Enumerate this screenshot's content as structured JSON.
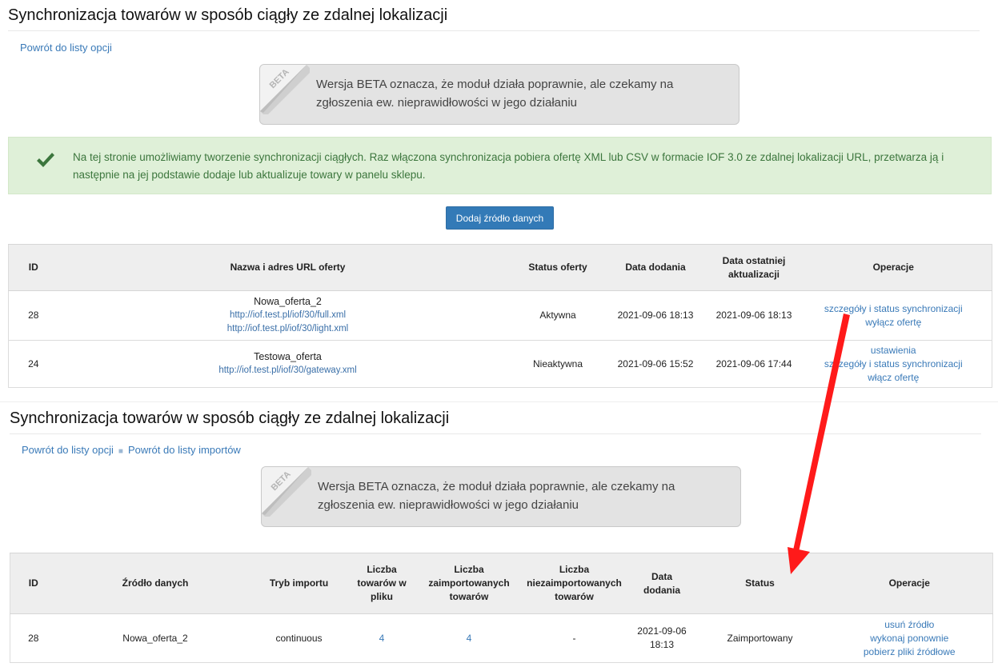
{
  "panel1": {
    "title": "Synchronizacja towarów w sposób ciągły ze zdalnej lokalizacji",
    "back_link": "Powrót do listy opcji",
    "beta_label": "BETA",
    "beta_text": "Wersja BETA oznacza, że moduł działa poprawnie, ale czekamy na zgłoszenia ew. nieprawidłowości w jego działaniu",
    "info_text": "Na tej stronie umożliwiamy tworzenie synchronizacji ciągłych. Raz włączona synchronizacja pobiera ofertę XML lub CSV w formacie IOF 3.0 ze zdalnej lokalizacji URL, przetwarza ją i następnie na jej podstawie dodaje lub aktualizuje towary w panelu sklepu.",
    "add_button": "Dodaj źródło danych",
    "table": {
      "headers": {
        "id": "ID",
        "name": "Nazwa i adres URL oferty",
        "status": "Status oferty",
        "added": "Data dodania",
        "updated": "Data ostatniej aktualizacji",
        "ops": "Operacje"
      },
      "rows": [
        {
          "id": "28",
          "name": "Nowa_oferta_2",
          "url1": "http://iof.test.pl/iof/30/full.xml",
          "url2": "http://iof.test.pl/iof/30/light.xml",
          "status": "Aktywna",
          "added": "2021-09-06 18:13",
          "updated": "2021-09-06 18:13",
          "op1": "szczegóły i status synchronizacji",
          "op2": "wyłącz ofertę"
        },
        {
          "id": "24",
          "name": "Testowa_oferta",
          "url1": "http://iof.test.pl/iof/30/gateway.xml",
          "status": "Nieaktywna",
          "added": "2021-09-06 15:52",
          "updated": "2021-09-06 17:44",
          "op1": "ustawienia",
          "op2": "szczegóły i status synchronizacji",
          "op3": "włącz ofertę"
        }
      ]
    }
  },
  "panel2": {
    "title": "Synchronizacja towarów w sposób ciągły ze zdalnej lokalizacji",
    "back_link": "Powrót do listy opcji",
    "back_link2": "Powrót do listy importów",
    "beta_label": "BETA",
    "beta_text": "Wersja BETA oznacza, że moduł działa poprawnie, ale czekamy na zgłoszenia ew. nieprawidłowości w jego działaniu",
    "table": {
      "headers": {
        "id": "ID",
        "source": "Źródło danych",
        "mode": "Tryb importu",
        "in_file": "Liczba towarów w pliku",
        "imported": "Liczba zaimportowanych towarów",
        "not_imported": "Liczba niezaimportowanych towarów",
        "added": "Data dodania",
        "status": "Status",
        "ops": "Operacje"
      },
      "rows": [
        {
          "id": "28",
          "source": "Nowa_oferta_2",
          "mode": "continuous",
          "in_file": "4",
          "imported": "4",
          "not_imported": "-",
          "added": "2021-09-06 18:13",
          "status": "Zaimportowany",
          "op1": "usuń źródło",
          "op2": "wykonaj ponownie",
          "op3": "pobierz pliki źródłowe"
        }
      ]
    }
  },
  "colors": {
    "link": "#3a7ab8",
    "primary_button": "#337ab7",
    "info_bg": "#dff0d8",
    "info_text": "#3c763d",
    "active": "#2e8b2e",
    "inactive": "#d9261c",
    "arrow": "#ff0000"
  },
  "icons": {
    "beta": "beta-corner-badge-icon",
    "check": "checkmark-icon",
    "annotation": "red-arrow-icon"
  }
}
